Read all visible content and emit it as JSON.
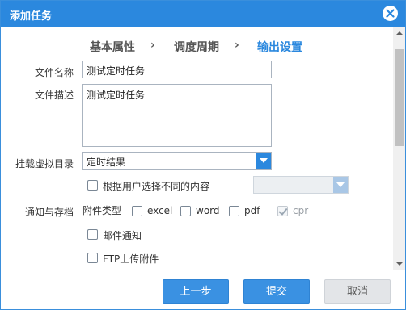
{
  "dialog": {
    "title": "添加任务",
    "close_icon": "close-icon"
  },
  "steps": [
    {
      "label": "基本属性",
      "active": false
    },
    {
      "label": "调度周期",
      "active": false
    },
    {
      "label": "输出设置",
      "active": true
    }
  ],
  "step_separator": "›",
  "form": {
    "file_name_label": "文件名称",
    "file_name_value": "测试定时任务",
    "file_desc_label": "文件描述",
    "file_desc_value": "测试定时任务",
    "mount_dir_label": "挂载虚拟目录",
    "mount_dir_value": "定时结果",
    "per_user_label": "根据用户选择不同的内容",
    "per_user_select_value": "",
    "notify_label": "通知与存档",
    "attach_type_label": "附件类型",
    "attach_types": [
      {
        "label": "excel",
        "checked": false,
        "disabled": false
      },
      {
        "label": "word",
        "checked": false,
        "disabled": false
      },
      {
        "label": "pdf",
        "checked": false,
        "disabled": false
      },
      {
        "label": "cpr",
        "checked": true,
        "disabled": true
      }
    ],
    "email_notify_label": "邮件通知",
    "ftp_upload_label": "FTP上传附件"
  },
  "footer": {
    "prev_label": "上一步",
    "submit_label": "提交",
    "cancel_label": "取消"
  },
  "colors": {
    "titlebar": "#2b88de",
    "accent": "#2b88de",
    "primary_button": "#3a91e2",
    "disabled_button": "#e3e5e8"
  }
}
